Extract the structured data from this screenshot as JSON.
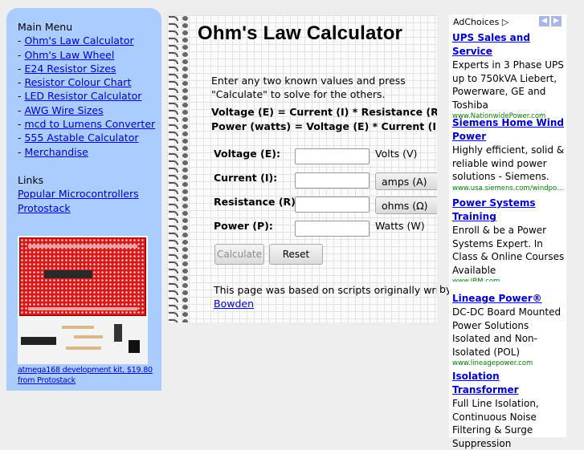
{
  "sidebar": {
    "heading": "Main Menu",
    "menu": [
      "Ohm's Law Calculator",
      "Ohm's Law Wheel",
      "E24 Resistor Sizes",
      "Resistor Colour Chart",
      "LED Resistor Calculator",
      "AWG Wire Sizes",
      "mcd to Lumens Converter",
      "555 Astable Calculator",
      "Merchandise"
    ],
    "links_heading": "Links",
    "links": [
      "Popular Microcontrollers",
      "Protostack"
    ],
    "promo_caption": "atmega168 development kit, $19.80 from Protostack"
  },
  "calculator": {
    "title": "Ohm's Law Calculator",
    "intro": "Enter any two known values and press \"Calculate\" to solve for the others.",
    "formula_1": "Voltage (E) = Current (I) * Resistance (R)",
    "formula_2": "Power (watts) = Voltage (E) * Current (I)",
    "rows": [
      {
        "label": "Voltage (E):",
        "value": "",
        "unit": "Volts (V)"
      },
      {
        "label": "Current (I):",
        "value": "",
        "unit": "amps (A)"
      },
      {
        "label": "Resistance (R):",
        "value": "",
        "unit": "ohms (Ω)"
      },
      {
        "label": "Power (P):",
        "value": "",
        "unit": "Watts (W)"
      }
    ],
    "calculate_label": "Calculate",
    "reset_label": "Reset",
    "footer_text": "This page was based on scripts originally writt",
    "footer_by": "by",
    "footer_link": "Bowden"
  },
  "ads": {
    "header": "AdChoices",
    "items": [
      {
        "title": "UPS Sales and Service",
        "body": "Experts in 3 Phase UPS up to 750kVA Liebert, Powerware, GE and Toshiba",
        "url": "www.NationwidePower.com"
      },
      {
        "title": "Siemens Home Wind Power",
        "body": "Highly efficient, solid & reliable wind power solutions - Siemens.",
        "url": "www.usa.siemens.com/windpo..."
      },
      {
        "title": "Power Systems Training",
        "body": "Enroll & be a Power Systems Expert. In Class & Online Courses Available",
        "url": "www.IBM.com"
      },
      {
        "title": "Lineage Power®",
        "body": "DC-DC Board Mounted Power Solutions Isolated and Non-Isolated (POL)",
        "url": "www.lineagepower.com"
      },
      {
        "title": "Isolation Transformer",
        "body": "Full Line Isolation, Continuous Noise Filtering & Surge Suppression",
        "url": ""
      }
    ]
  }
}
